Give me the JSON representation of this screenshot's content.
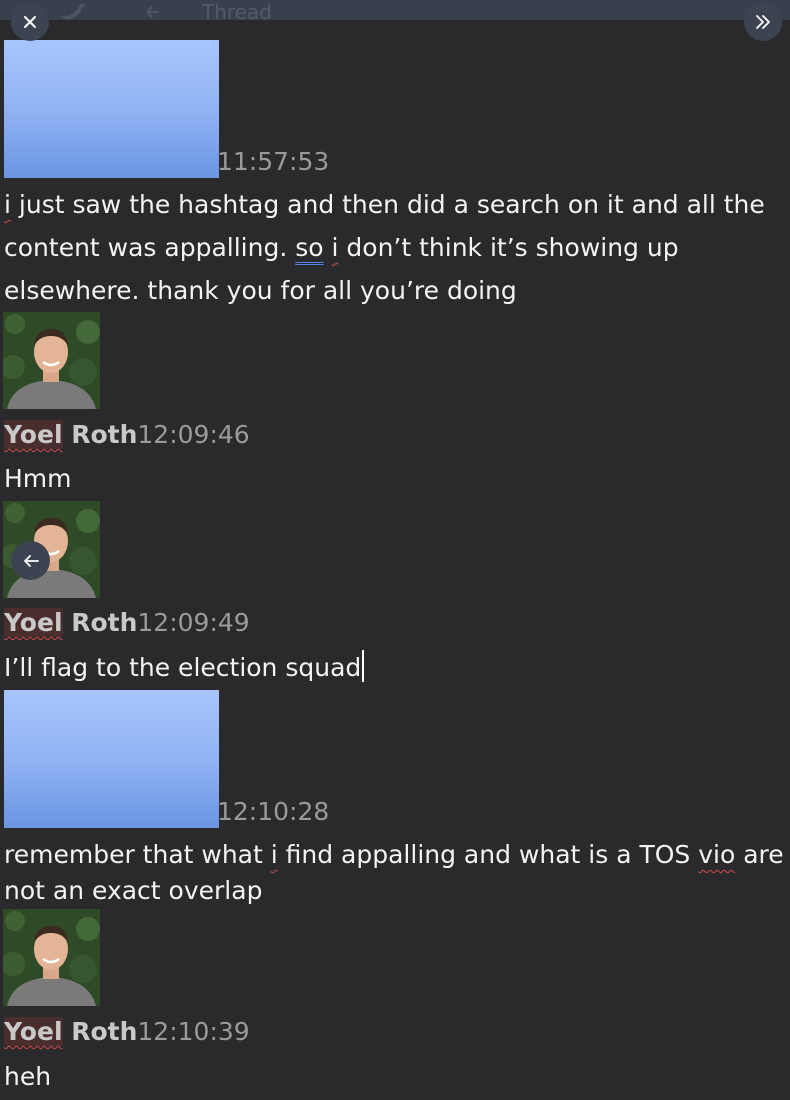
{
  "header": {
    "title": "Thread",
    "close_icon": "close-icon",
    "expand_icon": "double-chevron-right-icon",
    "back_icon": "arrow-left-icon"
  },
  "messages": [
    {
      "avatar": "redacted",
      "time": "11:57:53",
      "text_parts": {
        "a": "i",
        "b": " just saw the hashtag and then did a search on it and all the content was appalling. ",
        "c": "so",
        "d": " ",
        "e": "i",
        "f": " don’t think it’s showing up elsewhere. thank you for all you’re doing"
      }
    },
    {
      "avatar": "photo",
      "author_first": "Yoel",
      "author_last": " Roth",
      "time": "12:09:46",
      "text": "Hmm"
    },
    {
      "avatar": "photo",
      "author_first": "Yoel",
      "author_last": " Roth",
      "time": "12:09:49",
      "text": "I’ll flag to the election squad"
    },
    {
      "avatar": "redacted",
      "time": "12:10:28",
      "text_parts": {
        "a": "remember that what ",
        "b": "i",
        "c": " find appalling and what is a TOS ",
        "d": "vio",
        "e": " are not an exact overlap"
      }
    },
    {
      "avatar": "photo",
      "author_first": "Yoel",
      "author_last": " Roth",
      "time": "12:10:39",
      "text": "heh"
    }
  ],
  "colors": {
    "background": "#2a2a2c",
    "text": "#f3f3f3",
    "timestamp": "#9a9a9a",
    "spellcheck": "#d14b4b",
    "grammarcheck": "#5a7fe6",
    "redacted_avatar": "#91b3f4"
  }
}
